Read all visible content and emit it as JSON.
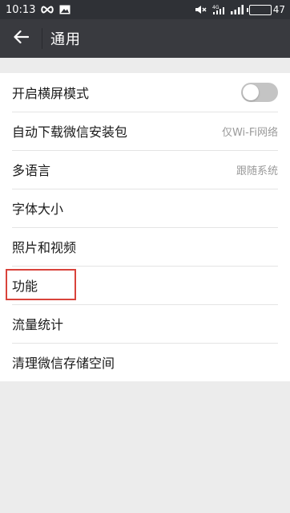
{
  "status_bar": {
    "time": "10:13",
    "left_icons": [
      "infinity-icon",
      "image-icon"
    ],
    "right_icons": [
      "mute-icon",
      "signal-4g-icon",
      "signal-bars-icon",
      "battery-icon"
    ],
    "network_label": "4G",
    "battery_level": "47"
  },
  "header": {
    "title": "通用",
    "back_icon": "arrow-left-icon"
  },
  "settings": {
    "landscape_mode": {
      "label": "开启横屏模式",
      "enabled": false
    },
    "auto_download": {
      "label": "自动下载微信安装包",
      "value": "仅Wi-Fi网络"
    },
    "language": {
      "label": "多语言",
      "value": "跟随系统"
    },
    "font_size": {
      "label": "字体大小"
    },
    "photos_videos": {
      "label": "照片和视频"
    },
    "features": {
      "label": "功能"
    },
    "data_usage": {
      "label": "流量统计"
    },
    "storage": {
      "label": "清理微信存储空间"
    }
  },
  "colors": {
    "status_bar_bg": "#2f3136",
    "header_bg": "#393a3f",
    "page_bg": "#ececec",
    "highlight": "#d9433b",
    "toggle_off": "#c4c4c4"
  }
}
